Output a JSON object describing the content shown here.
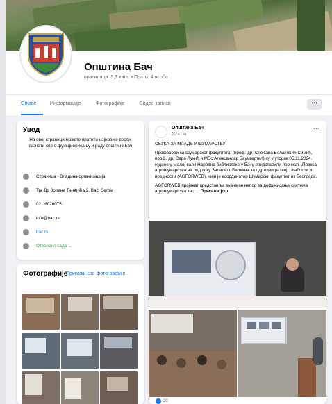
{
  "page": {
    "name": "Општина Бач",
    "stats": "пратилаца: 3,7 хиљ. • Прати: 4 особа"
  },
  "tabs": [
    {
      "label": "Објаве"
    },
    {
      "label": "Информације"
    },
    {
      "label": "Фотографије"
    },
    {
      "label": "Видео записи"
    }
  ],
  "more_button": "•••",
  "intro": {
    "title": "Увод",
    "description": "На овој страници можете пратити најновије вести, сазнати све о функционисању и раду општине Бач",
    "rows": [
      {
        "icon": "info-icon",
        "text": "Страница · Владина организација"
      },
      {
        "icon": "location-pin-icon",
        "text": "Трг Др Зорана Ђинђића 2, Bač, Serbia"
      },
      {
        "icon": "phone-icon",
        "text": "021 6070075"
      },
      {
        "icon": "mail-icon",
        "text": "info@bac.rs"
      },
      {
        "icon": "globe-icon",
        "text": "bac.rs"
      },
      {
        "icon": "clock-icon",
        "text": "Отворено сада  ⌄"
      }
    ]
  },
  "photos": {
    "title": "Фотографије",
    "see_all": "Прикажи све фотографије"
  },
  "post": {
    "author": "Општина Бач",
    "time": "20 ч · ⊕",
    "heading": "ОБУКА ЗА МЛАДЕ У ШУМАРСТВУ",
    "paragraph1": "Професори са Шумарског факултета, (проф. др. Снежана Белановић Симић, проф. др. Сара Лукић и MSc Александар Баумгертел) су у уторак 05.11.2024. године у Малој сали Народне библиотеке у Бачу представили пројекат „Пракса агрошумарства на подручју Западног Балкана за одрживи развој: слабости и предности (AGFORWEB), чији је координатор Шумарски факултет из Београда.",
    "paragraph2": "AGFORWEB пројекат представља значајан напор за дефинисање система агрошумарства као ...",
    "see_more": "Прикажи још",
    "like_count": "20"
  },
  "colors": {
    "accent": "#1877f2",
    "open": "#31a24c",
    "secondary_text": "#65676b"
  }
}
